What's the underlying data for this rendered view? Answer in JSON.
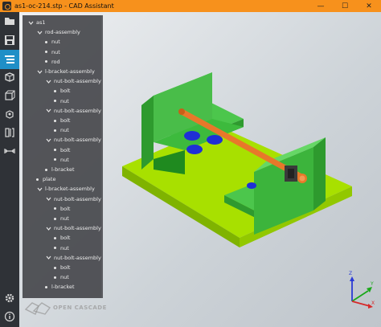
{
  "window": {
    "title": "as1-oc-214.stp - CAD Assistant",
    "controls": {
      "minimize": "—",
      "maximize": "☐",
      "close": "✕"
    }
  },
  "sidebar": {
    "items": [
      {
        "icon": "folder-open-icon"
      },
      {
        "icon": "save-icon"
      },
      {
        "icon": "model-tree-icon",
        "active": true
      },
      {
        "icon": "view-cube-icon"
      },
      {
        "icon": "wireframe-box-icon"
      },
      {
        "icon": "explode-view-icon"
      },
      {
        "icon": "clipping-plane-icon"
      },
      {
        "icon": "measure-icon"
      },
      {
        "icon": "gear-icon"
      },
      {
        "icon": "info-icon"
      }
    ]
  },
  "tree": {
    "nodes": [
      {
        "label": "as1",
        "depth": 0,
        "expandable": true
      },
      {
        "label": "rod-assembly",
        "depth": 1,
        "expandable": true
      },
      {
        "label": "nut",
        "depth": 2
      },
      {
        "label": "nut",
        "depth": 2
      },
      {
        "label": "rod",
        "depth": 2
      },
      {
        "label": "l-bracket-assembly",
        "depth": 1,
        "expandable": true
      },
      {
        "label": "nut-bolt-assembly",
        "depth": 2,
        "expandable": true
      },
      {
        "label": "bolt",
        "depth": 3
      },
      {
        "label": "nut",
        "depth": 3
      },
      {
        "label": "nut-bolt-assembly",
        "depth": 2,
        "expandable": true
      },
      {
        "label": "bolt",
        "depth": 3
      },
      {
        "label": "nut",
        "depth": 3
      },
      {
        "label": "nut-bolt-assembly",
        "depth": 2,
        "expandable": true
      },
      {
        "label": "bolt",
        "depth": 3
      },
      {
        "label": "nut",
        "depth": 3
      },
      {
        "label": "l-bracket",
        "depth": 2
      },
      {
        "label": "plate",
        "depth": 1
      },
      {
        "label": "l-bracket-assembly",
        "depth": 1,
        "expandable": true
      },
      {
        "label": "nut-bolt-assembly",
        "depth": 2,
        "expandable": true
      },
      {
        "label": "bolt",
        "depth": 3
      },
      {
        "label": "nut",
        "depth": 3
      },
      {
        "label": "nut-bolt-assembly",
        "depth": 2,
        "expandable": true
      },
      {
        "label": "bolt",
        "depth": 3
      },
      {
        "label": "nut",
        "depth": 3
      },
      {
        "label": "nut-bolt-assembly",
        "depth": 2,
        "expandable": true
      },
      {
        "label": "bolt",
        "depth": 3
      },
      {
        "label": "nut",
        "depth": 3
      },
      {
        "label": "l-bracket",
        "depth": 2
      }
    ]
  },
  "watermark": {
    "text": "OPEN CASCADE"
  },
  "triad": {
    "x": "X",
    "y": "Y",
    "z": "Z"
  },
  "colors": {
    "titlebar": "#f7911c",
    "sidebar": "#2f3237",
    "active_tool": "#1f8fc7",
    "plate": "#a8e000",
    "bracket": "#3cb43c",
    "bolt": "#1f2fd6",
    "rod": "#e8782a"
  }
}
